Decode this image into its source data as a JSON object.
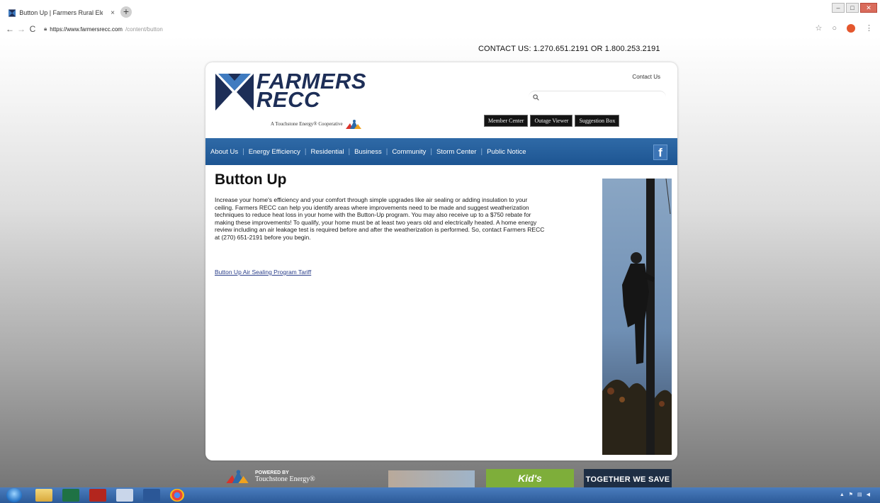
{
  "browser": {
    "tab_title": "Button Up | Farmers Rural Elect",
    "tab_close": "×",
    "new_tab": "+",
    "url_host": "https://www.farmersrecc.com",
    "url_path": "/content/button"
  },
  "site": {
    "contact_bar": "CONTACT US: 1.270.651.2191 OR 1.800.253.2191",
    "logo_line1": "FARMERS",
    "logo_line2": "RECC",
    "logo_tagline": "A Touchstone Energy® Cooperative",
    "contact_link": "Contact Us",
    "header_buttons": [
      "Member Center",
      "Outage Viewer",
      "Suggestion Box"
    ],
    "nav": [
      "About Us",
      "Energy Efficiency",
      "Residential",
      "Business",
      "Community",
      "Storm Center",
      "Public Notice"
    ],
    "facebook_label": "f"
  },
  "content": {
    "title": "Button Up",
    "body": "Increase your home's efficiency and your comfort through simple upgrades like air sealing or adding insulation to your ceiling. Farmers RECC can help you identify areas where improvements need to be made and suggest weatherization techniques to reduce heat loss in your home with the Button-Up program. You may also receive up to a $750 rebate for making these improvements! To qualify, your home must be at least two years old and electrically heated. A home energy review including an air leakage test is required before and after the weatherization is performed. So, contact Farmers RECC at (270) 651-2191 before you begin.",
    "link": "Button Up Air Sealing Program Tariff"
  },
  "footer": {
    "powered_by": "POWERED BY",
    "powered_name": "Touchstone Energy®",
    "promo2": "Kid's",
    "promo3": "TOGETHER WE SAVE"
  },
  "colors": {
    "nav_blue": "#1d5592",
    "logo_navy": "#1d2e57",
    "taskbar_blue": "#2c5a98"
  }
}
